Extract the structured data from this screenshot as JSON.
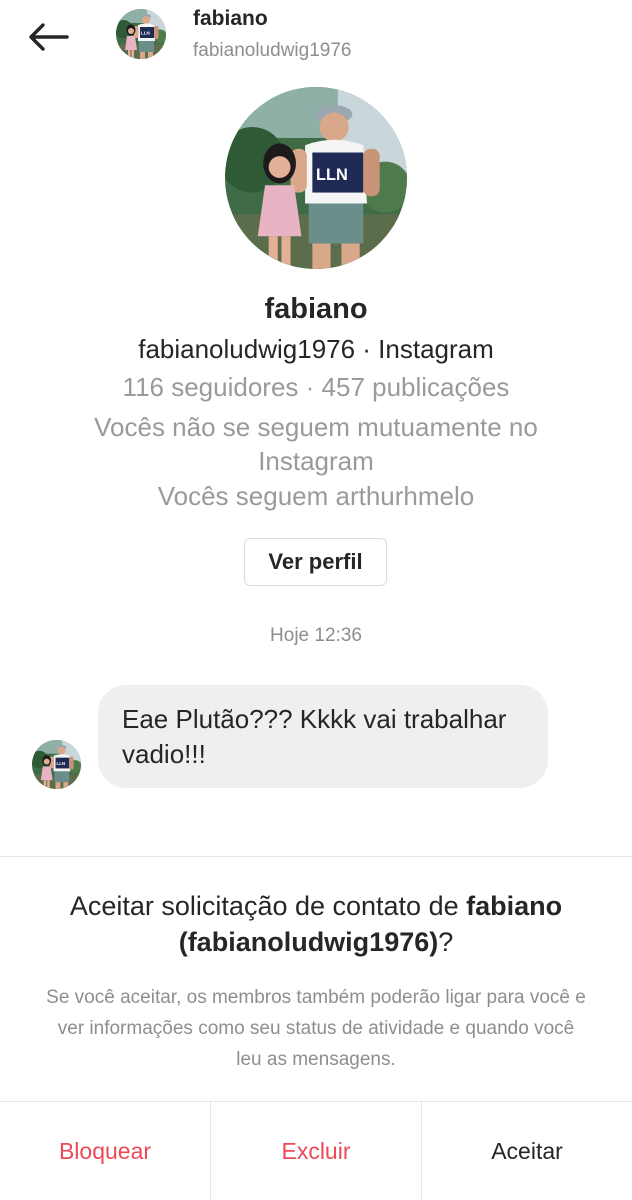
{
  "header": {
    "name": "fabiano",
    "handle": "fabianoludwig1976"
  },
  "profile": {
    "name": "fabiano",
    "handle_line": "fabianoludwig1976 · Instagram",
    "stats": "116 seguidores · 457 publicações",
    "mutual_note": "Vocês não se seguem mutuamente no Instagram",
    "follow_note": "Vocês seguem arthurhmelo",
    "view_profile_label": "Ver perfil"
  },
  "conversation": {
    "timestamp": "Hoje 12:36",
    "messages": [
      {
        "text": "Eae Plutão??? Kkkk vai trabalhar vadio!!!"
      }
    ]
  },
  "request": {
    "title_prefix": "Aceitar solicitação de contato de ",
    "title_name": "fabiano (fabianoludwig1976)",
    "title_suffix": "?",
    "description": "Se você aceitar, os membros também poderão ligar para você e ver informações como seu status de atividade e quando você leu as mensagens.",
    "actions": {
      "block": "Bloquear",
      "delete": "Excluir",
      "accept": "Aceitar"
    }
  },
  "colors": {
    "danger": "#ed4956",
    "text": "#262626",
    "muted": "#8e8e8e",
    "bubble": "#efefef"
  },
  "icons": {
    "back": "arrow-left-icon"
  }
}
